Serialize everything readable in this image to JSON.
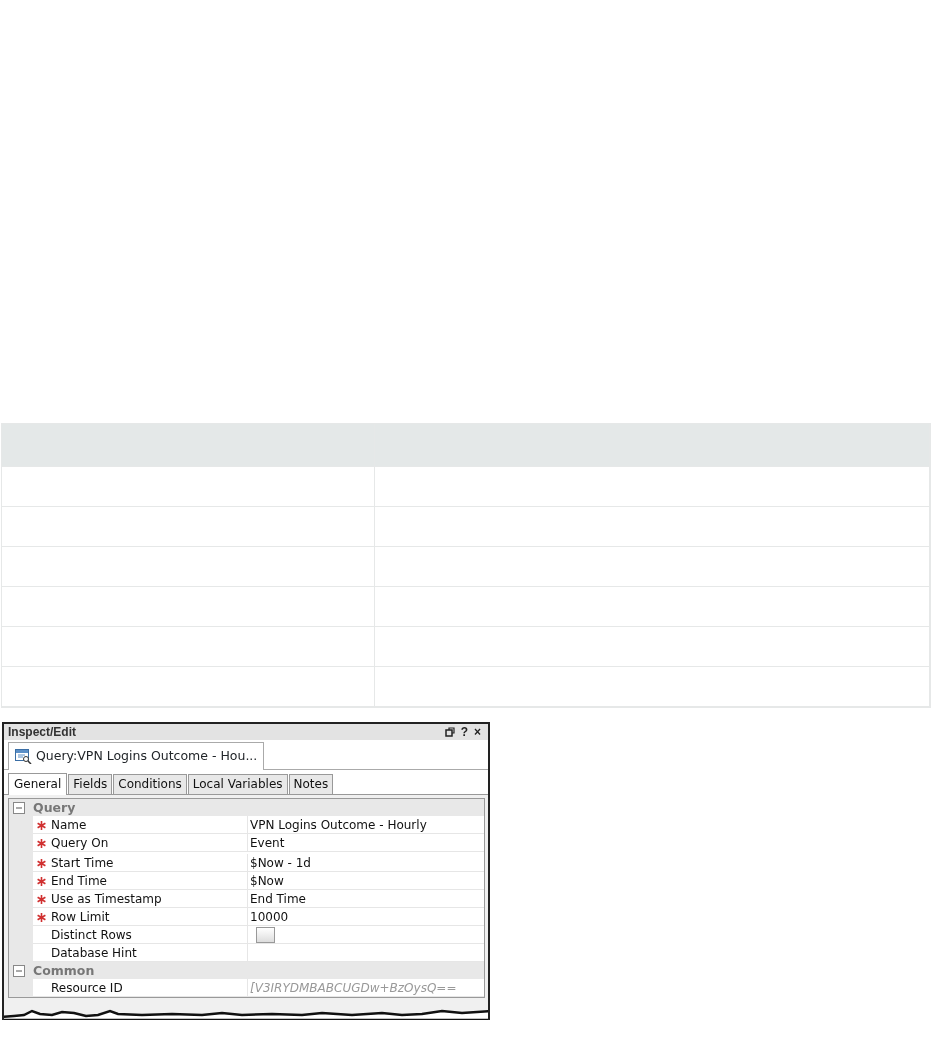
{
  "panel": {
    "title": "Inspect/Edit",
    "controls": [
      {
        "kind": "restore"
      },
      {
        "kind": "text",
        "label": "?"
      },
      {
        "kind": "text",
        "label": "×"
      }
    ]
  },
  "document_tab": {
    "label": "Query:VPN Logins Outcome - Hou..."
  },
  "tabs": [
    {
      "label": "General",
      "selected": true
    },
    {
      "label": "Fields",
      "selected": false
    },
    {
      "label": "Conditions",
      "selected": false
    },
    {
      "label": "Local Variables",
      "selected": false
    },
    {
      "label": "Notes",
      "selected": false
    }
  ],
  "groups": [
    {
      "title": "Query",
      "expanded": true,
      "rows": [
        {
          "label": "Name",
          "required": true,
          "kind": "text",
          "value": "VPN Logins Outcome - Hourly"
        },
        {
          "label": "Query On",
          "required": true,
          "kind": "text",
          "value": "Event"
        },
        {
          "label": "Start Time",
          "required": true,
          "kind": "text",
          "value": "$Now - 1d"
        },
        {
          "label": "End Time",
          "required": true,
          "kind": "text",
          "value": "$Now"
        },
        {
          "label": "Use as Timestamp",
          "required": true,
          "kind": "text",
          "value": "End Time"
        },
        {
          "label": "Row Limit",
          "required": true,
          "kind": "text",
          "value": "10000"
        },
        {
          "label": "Distinct Rows",
          "required": false,
          "kind": "checkbox",
          "checked": false
        },
        {
          "label": "Database Hint",
          "required": false,
          "kind": "text"
        }
      ]
    },
    {
      "title": "Common",
      "expanded": true,
      "rows": [
        {
          "label": "Resource ID",
          "required": false,
          "kind": "text",
          "value": "[V3IRYDMBABCUGDw+BzOysQ==",
          "readonly": true
        }
      ]
    }
  ]
}
